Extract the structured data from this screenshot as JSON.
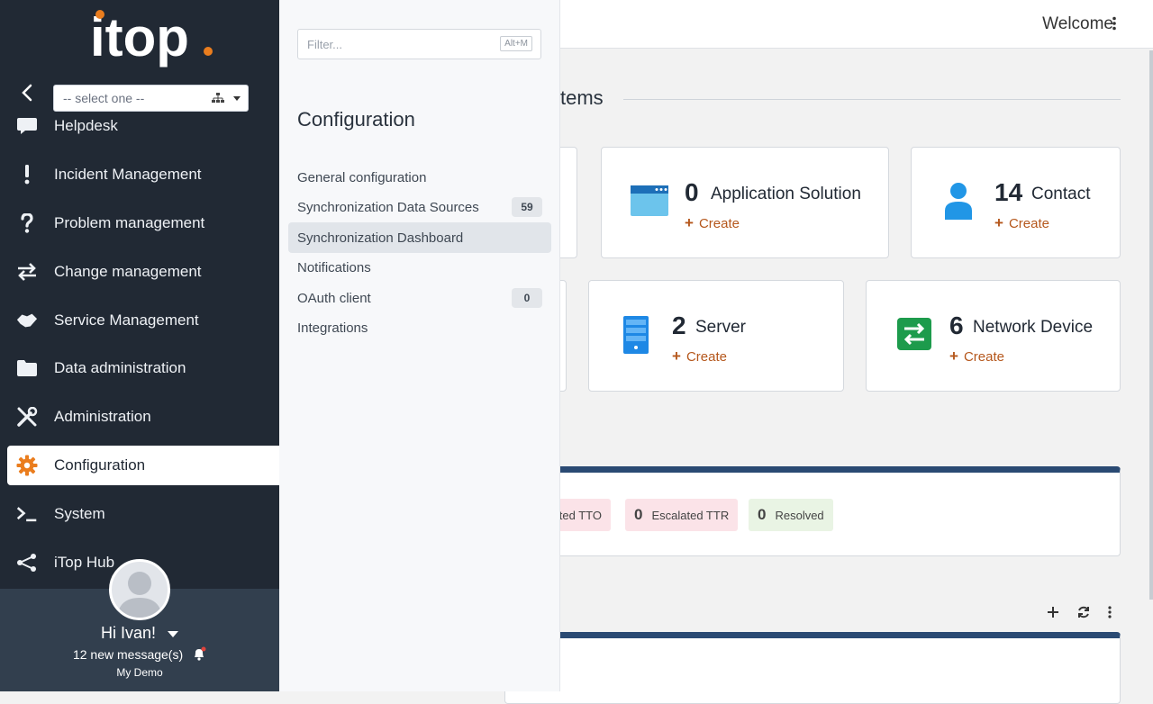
{
  "sidebar": {
    "org_select_placeholder": "-- select one --",
    "menu": [
      {
        "label": "Helpdesk",
        "icon": "speech-bubble-icon"
      },
      {
        "label": "Incident Management",
        "icon": "exclamation-icon"
      },
      {
        "label": "Problem management",
        "icon": "question-icon"
      },
      {
        "label": "Change management",
        "icon": "arrows-exchange-icon"
      },
      {
        "label": "Service Management",
        "icon": "handshake-icon"
      },
      {
        "label": "Data administration",
        "icon": "folder-icon"
      },
      {
        "label": "Administration",
        "icon": "tools-icon"
      },
      {
        "label": "Configuration",
        "icon": "gear-icon",
        "active": true
      },
      {
        "label": "System",
        "icon": "terminal-icon"
      },
      {
        "label": "iTop Hub",
        "icon": "share-icon"
      }
    ],
    "user": {
      "greeting": "Hi Ivan!",
      "messages": "12 new message(s)",
      "organization": "My Demo"
    }
  },
  "flyout": {
    "filter_placeholder": "Filter...",
    "filter_shortcut": "Alt+M",
    "title": "Configuration",
    "items": [
      {
        "label": "General configuration",
        "badge": ""
      },
      {
        "label": "Synchronization Data Sources",
        "badge": "59"
      },
      {
        "label": "Synchronization Dashboard",
        "badge": "",
        "active": true
      },
      {
        "label": "Notifications",
        "badge": ""
      },
      {
        "label": "OAuth client",
        "badge": "0"
      },
      {
        "label": "Integrations",
        "badge": ""
      }
    ]
  },
  "topbar": {
    "welcome": "Welcome"
  },
  "dashboard": {
    "section_title_fragment": "tems",
    "create_label": "Create",
    "cards": [
      {
        "count": "0",
        "name": "Application Solution",
        "icon": "application-window-icon"
      },
      {
        "count": "14",
        "name": "Contact",
        "icon": "person-icon"
      },
      {
        "count": "2",
        "name": "Server",
        "icon": "server-icon"
      },
      {
        "count": "6",
        "name": "Network Device",
        "icon": "network-device-icon"
      }
    ],
    "chips": [
      {
        "count": "",
        "label": "ted TTO"
      },
      {
        "count": "0",
        "label": "Escalated TTR"
      },
      {
        "count": "0",
        "label": "Resolved"
      }
    ]
  },
  "colors": {
    "sidebar": "#212934",
    "accent": "#ea7d1e",
    "create": "#b5571c",
    "panel_header": "#2a4a73"
  }
}
